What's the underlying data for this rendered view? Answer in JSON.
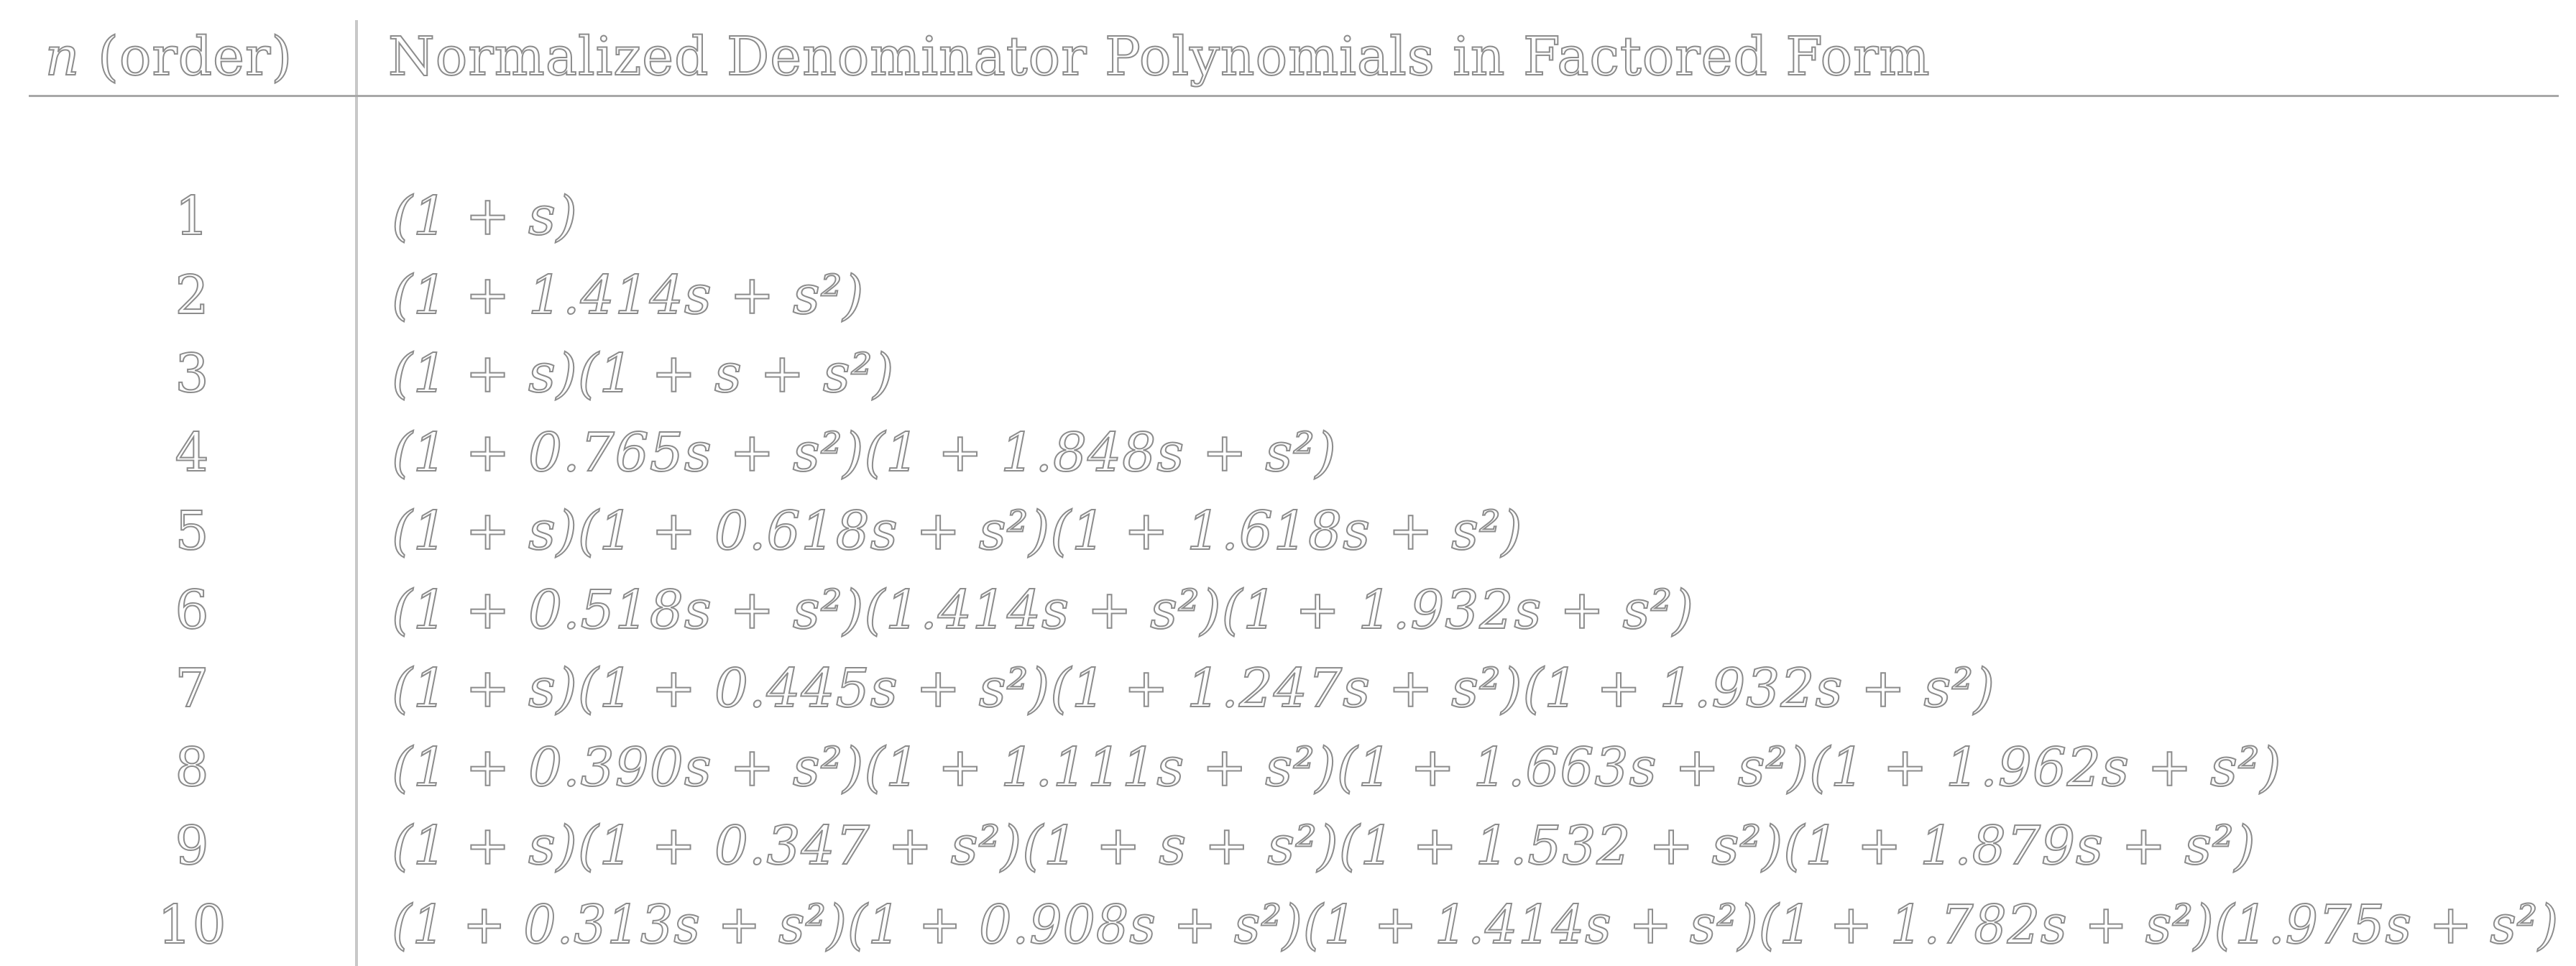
{
  "header": {
    "n_var": "n",
    "n_rest": " (order)",
    "title": "Normalized Denominator Polynomials in Factored Form"
  },
  "rows": [
    {
      "n": "1",
      "poly": "(1 + s)"
    },
    {
      "n": "2",
      "poly": "(1 + 1.414s + s²)"
    },
    {
      "n": "3",
      "poly": "(1 + s)(1 + s + s²)"
    },
    {
      "n": "4",
      "poly": "(1 + 0.765s + s²)(1 + 1.848s + s²)"
    },
    {
      "n": "5",
      "poly": "(1 + s)(1 + 0.618s + s²)(1 + 1.618s + s²)"
    },
    {
      "n": "6",
      "poly": "(1 + 0.518s + s²)(1.414s + s²)(1 + 1.932s + s²)"
    },
    {
      "n": "7",
      "poly": "(1 + s)(1 + 0.445s + s²)(1 + 1.247s + s²)(1 + 1.932s + s²)"
    },
    {
      "n": "8",
      "poly": "(1 + 0.390s + s²)(1 + 1.111s + s²)(1 + 1.663s + s²)(1 + 1.962s + s²)"
    },
    {
      "n": "9",
      "poly": "(1 + s)(1 + 0.347 + s²)(1 + s + s²)(1 + 1.532 + s²)(1 + 1.879s + s²)"
    },
    {
      "n": "10",
      "poly": "(1 + 0.313s + s²)(1 + 0.908s + s²)(1 + 1.414s + s²)(1 + 1.782s + s²)(1.975s + s²)"
    }
  ]
}
